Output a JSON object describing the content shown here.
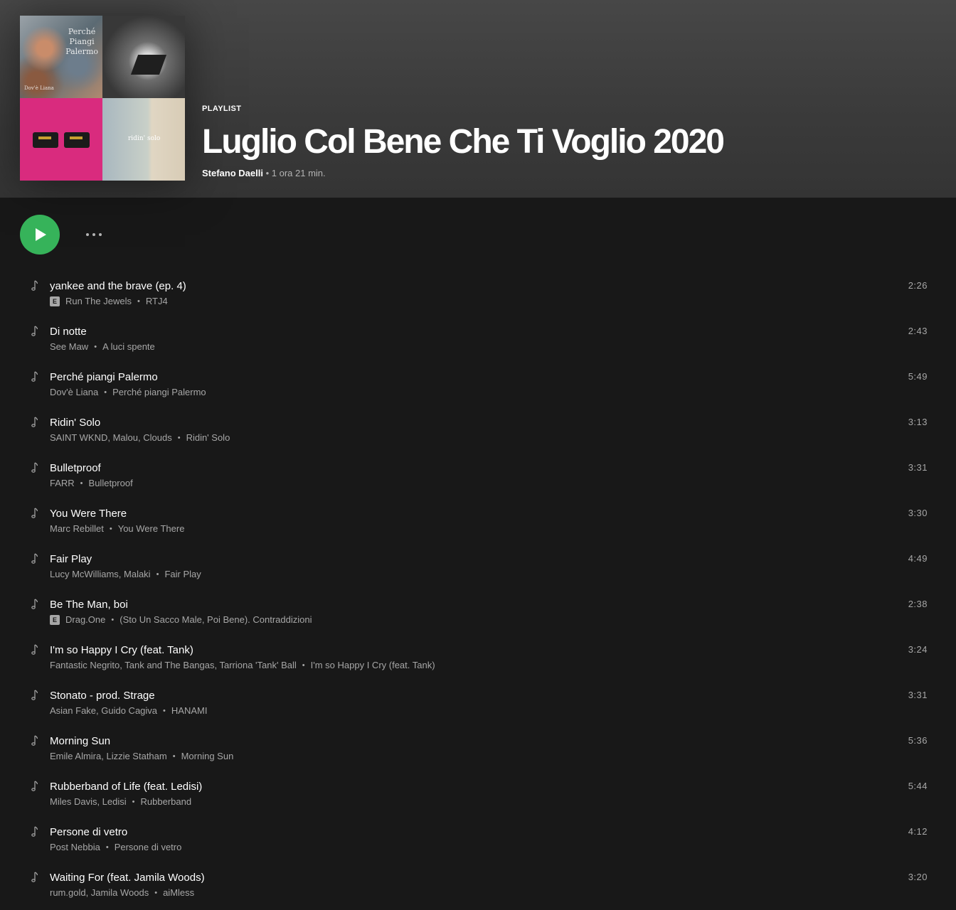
{
  "playlist": {
    "label": "PLAYLIST",
    "title": "Luglio Col Bene Che Ti Voglio 2020",
    "owner": "Stefano Daelli",
    "duration": "1 ora 21 min.",
    "cover_text": {
      "tile1_title_line1": "Perché",
      "tile1_title_line2": "Piangi",
      "tile1_title_line3": "Palermo",
      "tile1_artist": "Dov'è Liana",
      "tile4_text": "ridin' solo"
    }
  },
  "controls": {
    "play_icon": "play-icon",
    "more_icon": "more-icon"
  },
  "colors": {
    "accent": "#36b35a",
    "background": "#181818",
    "header": "#404040"
  },
  "tracks": [
    {
      "title": "yankee and the brave (ep. 4)",
      "explicit": "E",
      "artists": "Run The Jewels",
      "album": "RTJ4",
      "duration": "2:26"
    },
    {
      "title": "Di notte",
      "explicit": "",
      "artists": "See Maw",
      "album": "A luci spente",
      "duration": "2:43"
    },
    {
      "title": "Perché piangi Palermo",
      "explicit": "",
      "artists": "Dov'è Liana",
      "album": "Perché piangi Palermo",
      "duration": "5:49"
    },
    {
      "title": "Ridin' Solo",
      "explicit": "",
      "artists": "SAINT WKND, Malou, Clouds",
      "album": "Ridin' Solo",
      "duration": "3:13"
    },
    {
      "title": "Bulletproof",
      "explicit": "",
      "artists": "FARR",
      "album": "Bulletproof",
      "duration": "3:31"
    },
    {
      "title": "You Were There",
      "explicit": "",
      "artists": "Marc Rebillet",
      "album": "You Were There",
      "duration": "3:30"
    },
    {
      "title": "Fair Play",
      "explicit": "",
      "artists": "Lucy McWilliams, Malaki",
      "album": "Fair Play",
      "duration": "4:49"
    },
    {
      "title": "Be The Man, boi",
      "explicit": "E",
      "artists": "Drag.One",
      "album": "(Sto Un Sacco Male, Poi Bene). Contraddizioni",
      "duration": "2:38"
    },
    {
      "title": "I'm so Happy I Cry (feat. Tank)",
      "explicit": "",
      "artists": "Fantastic Negrito, Tank and The Bangas, Tarriona 'Tank' Ball",
      "album": "I'm so Happy I Cry (feat. Tank)",
      "duration": "3:24"
    },
    {
      "title": "Stonato - prod. Strage",
      "explicit": "",
      "artists": "Asian Fake, Guido Cagiva",
      "album": "HANAMI",
      "duration": "3:31"
    },
    {
      "title": "Morning Sun",
      "explicit": "",
      "artists": "Emile Almira, Lizzie Statham",
      "album": "Morning Sun",
      "duration": "5:36"
    },
    {
      "title": "Rubberband of Life (feat. Ledisi)",
      "explicit": "",
      "artists": "Miles Davis, Ledisi",
      "album": "Rubberband",
      "duration": "5:44"
    },
    {
      "title": "Persone di vetro",
      "explicit": "",
      "artists": "Post Nebbia",
      "album": "Persone di vetro",
      "duration": "4:12"
    },
    {
      "title": "Waiting For (feat. Jamila Woods)",
      "explicit": "",
      "artists": "rum.gold, Jamila Woods",
      "album": "aiMless",
      "duration": "3:20"
    }
  ]
}
